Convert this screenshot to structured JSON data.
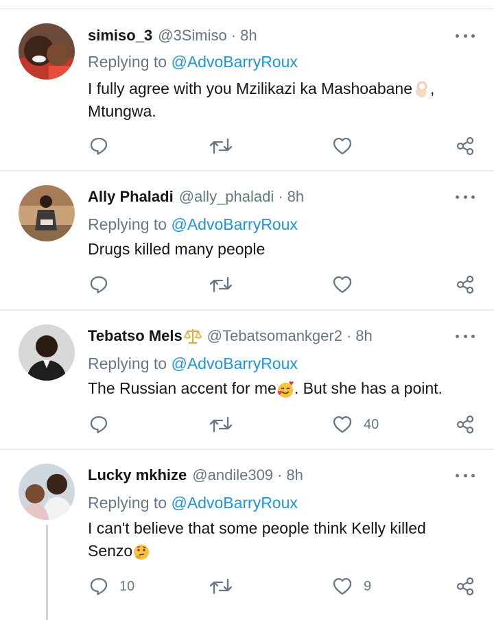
{
  "tweets": [
    {
      "name": "simiso_3",
      "handle": "@3Simiso",
      "time": "8h",
      "replying_label": "Replying to",
      "replying_to": "@AdvoBarryRoux",
      "text_line1": "I fully agree with you Mzilikazi ka Mashoabane",
      "text_line1_suffix": ",",
      "text_line2": "Mtungwa.",
      "emoji": "ok-hand-emoji",
      "reply_count": "",
      "retweet_count": "",
      "like_count": ""
    },
    {
      "name": "Ally Phaladi",
      "handle": "@ally_phaladi",
      "time": "8h",
      "replying_label": "Replying to",
      "replying_to": "@AdvoBarryRoux",
      "text_line1": "Drugs killed many people",
      "reply_count": "",
      "retweet_count": "",
      "like_count": ""
    },
    {
      "name": "Tebatso Mels",
      "handle": "@Tebatsomankger2",
      "time": "8h",
      "replying_label": "Replying to",
      "replying_to": "@AdvoBarryRoux",
      "text_before_emoji": "The Russian accent for me",
      "text_after_emoji": ". But she has a point.",
      "name_emoji": "balance-scale-emoji",
      "emoji": "smiling-face-with-hearts-emoji",
      "reply_count": "",
      "retweet_count": "",
      "like_count": "40"
    },
    {
      "name": "Lucky mkhize",
      "handle": "@andile309",
      "time": "8h",
      "replying_label": "Replying to",
      "replying_to": "@AdvoBarryRoux",
      "text_line1": "I can't believe that some people think Kelly killed",
      "text_line2": "Senzo",
      "emoji": "thinking-face-emoji",
      "reply_count": "10",
      "retweet_count": "",
      "like_count": "9"
    }
  ],
  "colors": {
    "mention": "#1b95e0",
    "secondary_text": "#657786",
    "primary_text": "#14171a",
    "divider": "#e6ecf0",
    "thread_line": "#ccd6dd"
  },
  "icons": [
    "reply-icon",
    "retweet-icon",
    "like-icon",
    "share-icon",
    "more-icon"
  ]
}
